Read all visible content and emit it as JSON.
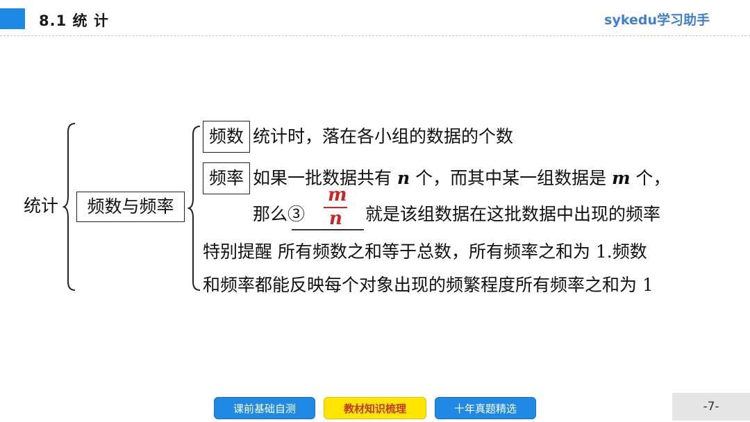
{
  "header": {
    "section_title": "8.1  统  计",
    "brand": "sykedu学习助手"
  },
  "content": {
    "root_label": "统计",
    "topic_box": "频数与频率",
    "frequency_count": {
      "term": "频数",
      "definition": "统计时，落在各小组的数据的个数"
    },
    "frequency_rate": {
      "term": "频率",
      "line1_a": "如果一批数据共有",
      "var_n": "n",
      "line1_b": "个，而其中某一组数据是",
      "var_m": "m",
      "line1_c": "个，",
      "line2_prefix": "那么③",
      "frac_numerator": "m",
      "frac_denominator": "n",
      "line2_suffix": "就是该组数据在这批数据中出现的频率"
    },
    "special_note": {
      "line1": "特别提醒  所有频数之和等于总数，所有频率之和为 1.频数",
      "line2": "和频率都能反映每个对象出现的频繁程度所有频率之和为 1"
    }
  },
  "footer": {
    "nav_buttons": [
      "课前基础自测",
      "教材知识梳理",
      "十年真题精选"
    ],
    "active_index": 1,
    "page_number": "-7-"
  },
  "colors": {
    "accent_blue": "#1e88e5",
    "brand_blue": "#3d7fd6",
    "answer_red": "#d62020",
    "active_yellow": "#ffe600"
  }
}
